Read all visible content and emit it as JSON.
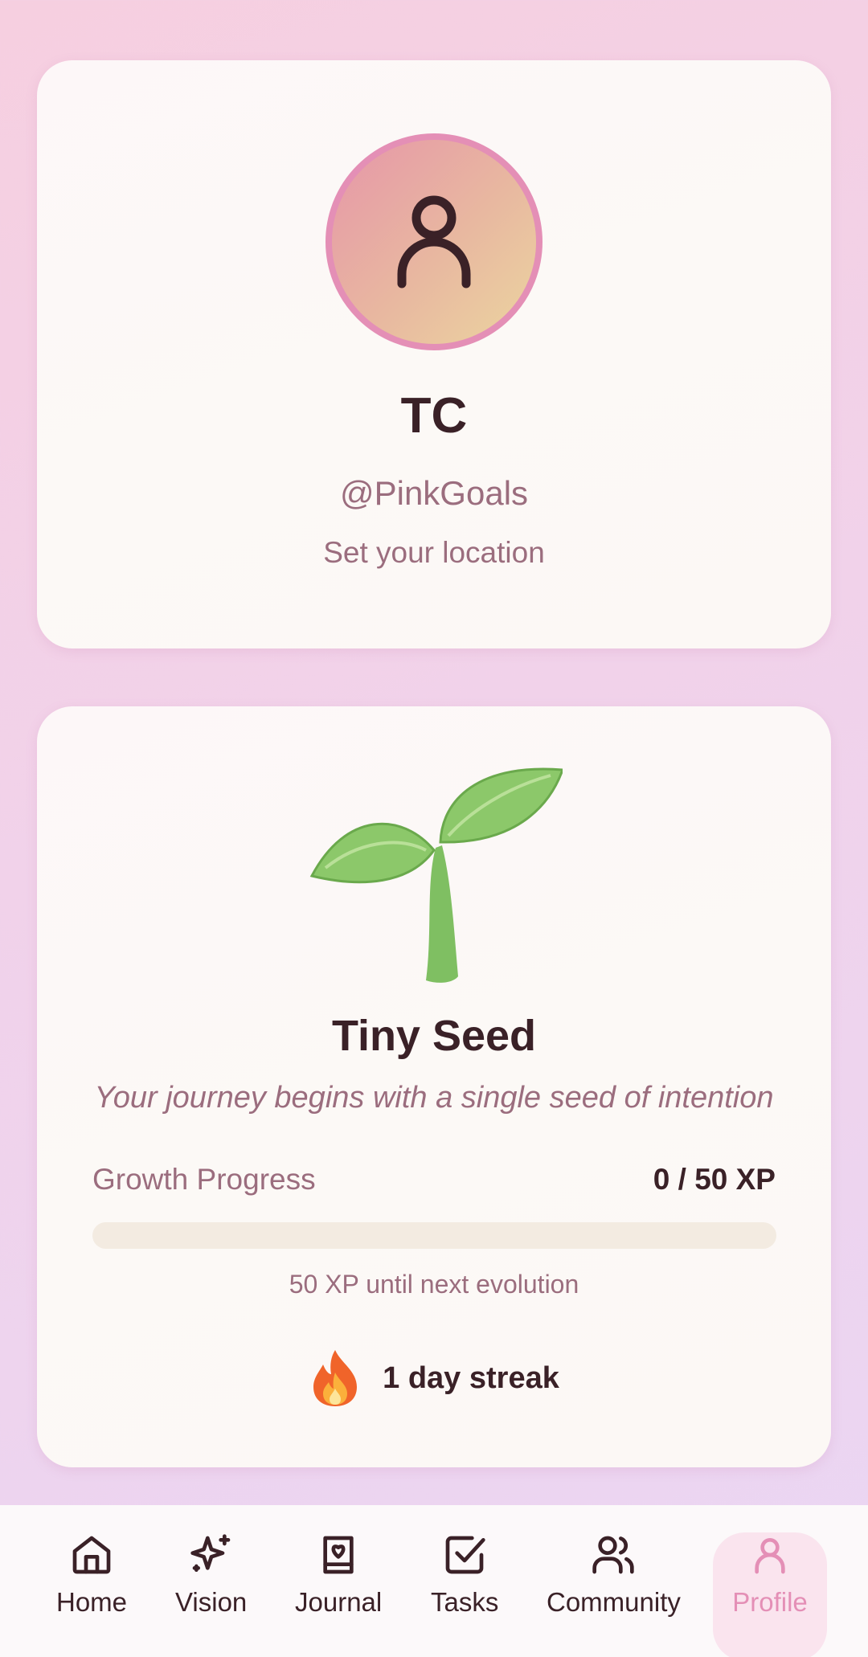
{
  "profile": {
    "name": "TC",
    "handle": "@PinkGoals",
    "location": "Set your location"
  },
  "growth": {
    "stage_title": "Tiny Seed",
    "stage_description": "Your journey begins with a single seed of intention",
    "progress_label": "Growth Progress",
    "progress_value": "0 / 50 XP",
    "progress_fraction": 0,
    "xp_remaining": "50 XP until next evolution",
    "streak_text": "1 day streak"
  },
  "nav": {
    "items": [
      {
        "label": "Home",
        "icon": "home-icon"
      },
      {
        "label": "Vision",
        "icon": "sparkle-icon"
      },
      {
        "label": "Journal",
        "icon": "journal-icon"
      },
      {
        "label": "Tasks",
        "icon": "check-square-icon"
      },
      {
        "label": "Community",
        "icon": "users-icon"
      },
      {
        "label": "Profile",
        "icon": "user-icon"
      }
    ],
    "active": "Profile"
  },
  "colors": {
    "accent": "#e48fb6",
    "text_primary": "#3a2127",
    "text_secondary": "#9b6d7e"
  }
}
